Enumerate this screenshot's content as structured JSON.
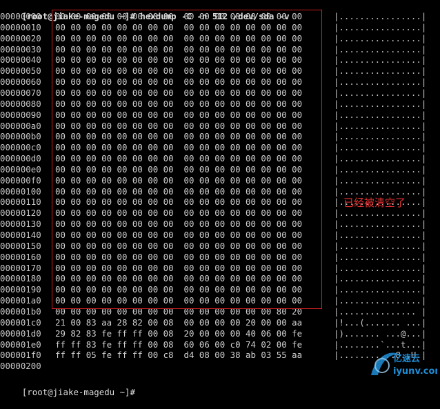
{
  "terminal": {
    "command_prompt": "[root@jiake-magedu ~]# hexdump -C -n 512 /dev/sda -v",
    "rows": [
      {
        "offset": "00000000",
        "hex": "00 00 00 00 00 00 00 00  00 00 00 00 00 00 00 00",
        "ascii": "|................|"
      },
      {
        "offset": "00000010",
        "hex": "00 00 00 00 00 00 00 00  00 00 00 00 00 00 00 00",
        "ascii": "|................|"
      },
      {
        "offset": "00000020",
        "hex": "00 00 00 00 00 00 00 00  00 00 00 00 00 00 00 00",
        "ascii": "|................|"
      },
      {
        "offset": "00000030",
        "hex": "00 00 00 00 00 00 00 00  00 00 00 00 00 00 00 00",
        "ascii": "|................|"
      },
      {
        "offset": "00000040",
        "hex": "00 00 00 00 00 00 00 00  00 00 00 00 00 00 00 00",
        "ascii": "|................|"
      },
      {
        "offset": "00000050",
        "hex": "00 00 00 00 00 00 00 00  00 00 00 00 00 00 00 00",
        "ascii": "|................|"
      },
      {
        "offset": "00000060",
        "hex": "00 00 00 00 00 00 00 00  00 00 00 00 00 00 00 00",
        "ascii": "|................|"
      },
      {
        "offset": "00000070",
        "hex": "00 00 00 00 00 00 00 00  00 00 00 00 00 00 00 00",
        "ascii": "|................|"
      },
      {
        "offset": "00000080",
        "hex": "00 00 00 00 00 00 00 00  00 00 00 00 00 00 00 00",
        "ascii": "|................|"
      },
      {
        "offset": "00000090",
        "hex": "00 00 00 00 00 00 00 00  00 00 00 00 00 00 00 00",
        "ascii": "|................|"
      },
      {
        "offset": "000000a0",
        "hex": "00 00 00 00 00 00 00 00  00 00 00 00 00 00 00 00",
        "ascii": "|................|"
      },
      {
        "offset": "000000b0",
        "hex": "00 00 00 00 00 00 00 00  00 00 00 00 00 00 00 00",
        "ascii": "|................|"
      },
      {
        "offset": "000000c0",
        "hex": "00 00 00 00 00 00 00 00  00 00 00 00 00 00 00 00",
        "ascii": "|................|"
      },
      {
        "offset": "000000d0",
        "hex": "00 00 00 00 00 00 00 00  00 00 00 00 00 00 00 00",
        "ascii": "|................|"
      },
      {
        "offset": "000000e0",
        "hex": "00 00 00 00 00 00 00 00  00 00 00 00 00 00 00 00",
        "ascii": "|................|"
      },
      {
        "offset": "000000f0",
        "hex": "00 00 00 00 00 00 00 00  00 00 00 00 00 00 00 00",
        "ascii": "|................|"
      },
      {
        "offset": "00000100",
        "hex": "00 00 00 00 00 00 00 00  00 00 00 00 00 00 00 00",
        "ascii": "|................|"
      },
      {
        "offset": "00000110",
        "hex": "00 00 00 00 00 00 00 00  00 00 00 00 00 00 00 00",
        "ascii": "|................|"
      },
      {
        "offset": "00000120",
        "hex": "00 00 00 00 00 00 00 00  00 00 00 00 00 00 00 00",
        "ascii": "|................|"
      },
      {
        "offset": "00000130",
        "hex": "00 00 00 00 00 00 00 00  00 00 00 00 00 00 00 00",
        "ascii": "|................|"
      },
      {
        "offset": "00000140",
        "hex": "00 00 00 00 00 00 00 00  00 00 00 00 00 00 00 00",
        "ascii": "|................|"
      },
      {
        "offset": "00000150",
        "hex": "00 00 00 00 00 00 00 00  00 00 00 00 00 00 00 00",
        "ascii": "|................|"
      },
      {
        "offset": "00000160",
        "hex": "00 00 00 00 00 00 00 00  00 00 00 00 00 00 00 00",
        "ascii": "|................|"
      },
      {
        "offset": "00000170",
        "hex": "00 00 00 00 00 00 00 00  00 00 00 00 00 00 00 00",
        "ascii": "|................|"
      },
      {
        "offset": "00000180",
        "hex": "00 00 00 00 00 00 00 00  00 00 00 00 00 00 00 00",
        "ascii": "|................|"
      },
      {
        "offset": "00000190",
        "hex": "00 00 00 00 00 00 00 00  00 00 00 00 00 00 00 00",
        "ascii": "|................|"
      },
      {
        "offset": "000001a0",
        "hex": "00 00 00 00 00 00 00 00  00 00 00 00 00 00 00 00",
        "ascii": "|................|"
      },
      {
        "offset": "000001b0",
        "hex": "00 00 00 00 00 00 00 00  00 00 00 00 00 00 80 20",
        "ascii": "|............... |"
      },
      {
        "offset": "000001c0",
        "hex": "21 00 83 aa 28 82 00 08  00 00 00 00 20 00 00 aa",
        "ascii": "|!...(....... ...|"
      },
      {
        "offset": "000001d0",
        "hex": "29 82 83 fe ff ff 00 08  20 00 00 00 40 06 00 fe",
        "ascii": "|)....... ...@...|"
      },
      {
        "offset": "000001e0",
        "hex": "ff ff 83 fe ff ff 00 08  60 06 00 c0 74 02 00 fe",
        "ascii": "|........`...t...|"
      },
      {
        "offset": "000001f0",
        "hex": "ff ff 05 fe ff ff 00 c8  d4 08 00 38 ab 03 55 aa",
        "ascii": "|...........8..U.|"
      },
      {
        "offset": "00000200",
        "hex": "",
        "ascii": ""
      }
    ],
    "trailing_prompt": "[root@jiake-magedu ~]#"
  },
  "annotation": {
    "text": "已经被清空了",
    "color": "#e03030"
  },
  "watermark": {
    "text": "亿速云",
    "sub_text": "iyunv.com"
  },
  "colors": {
    "background": "#000000",
    "foreground": "#c8c8c8",
    "highlight": "#d02020"
  }
}
